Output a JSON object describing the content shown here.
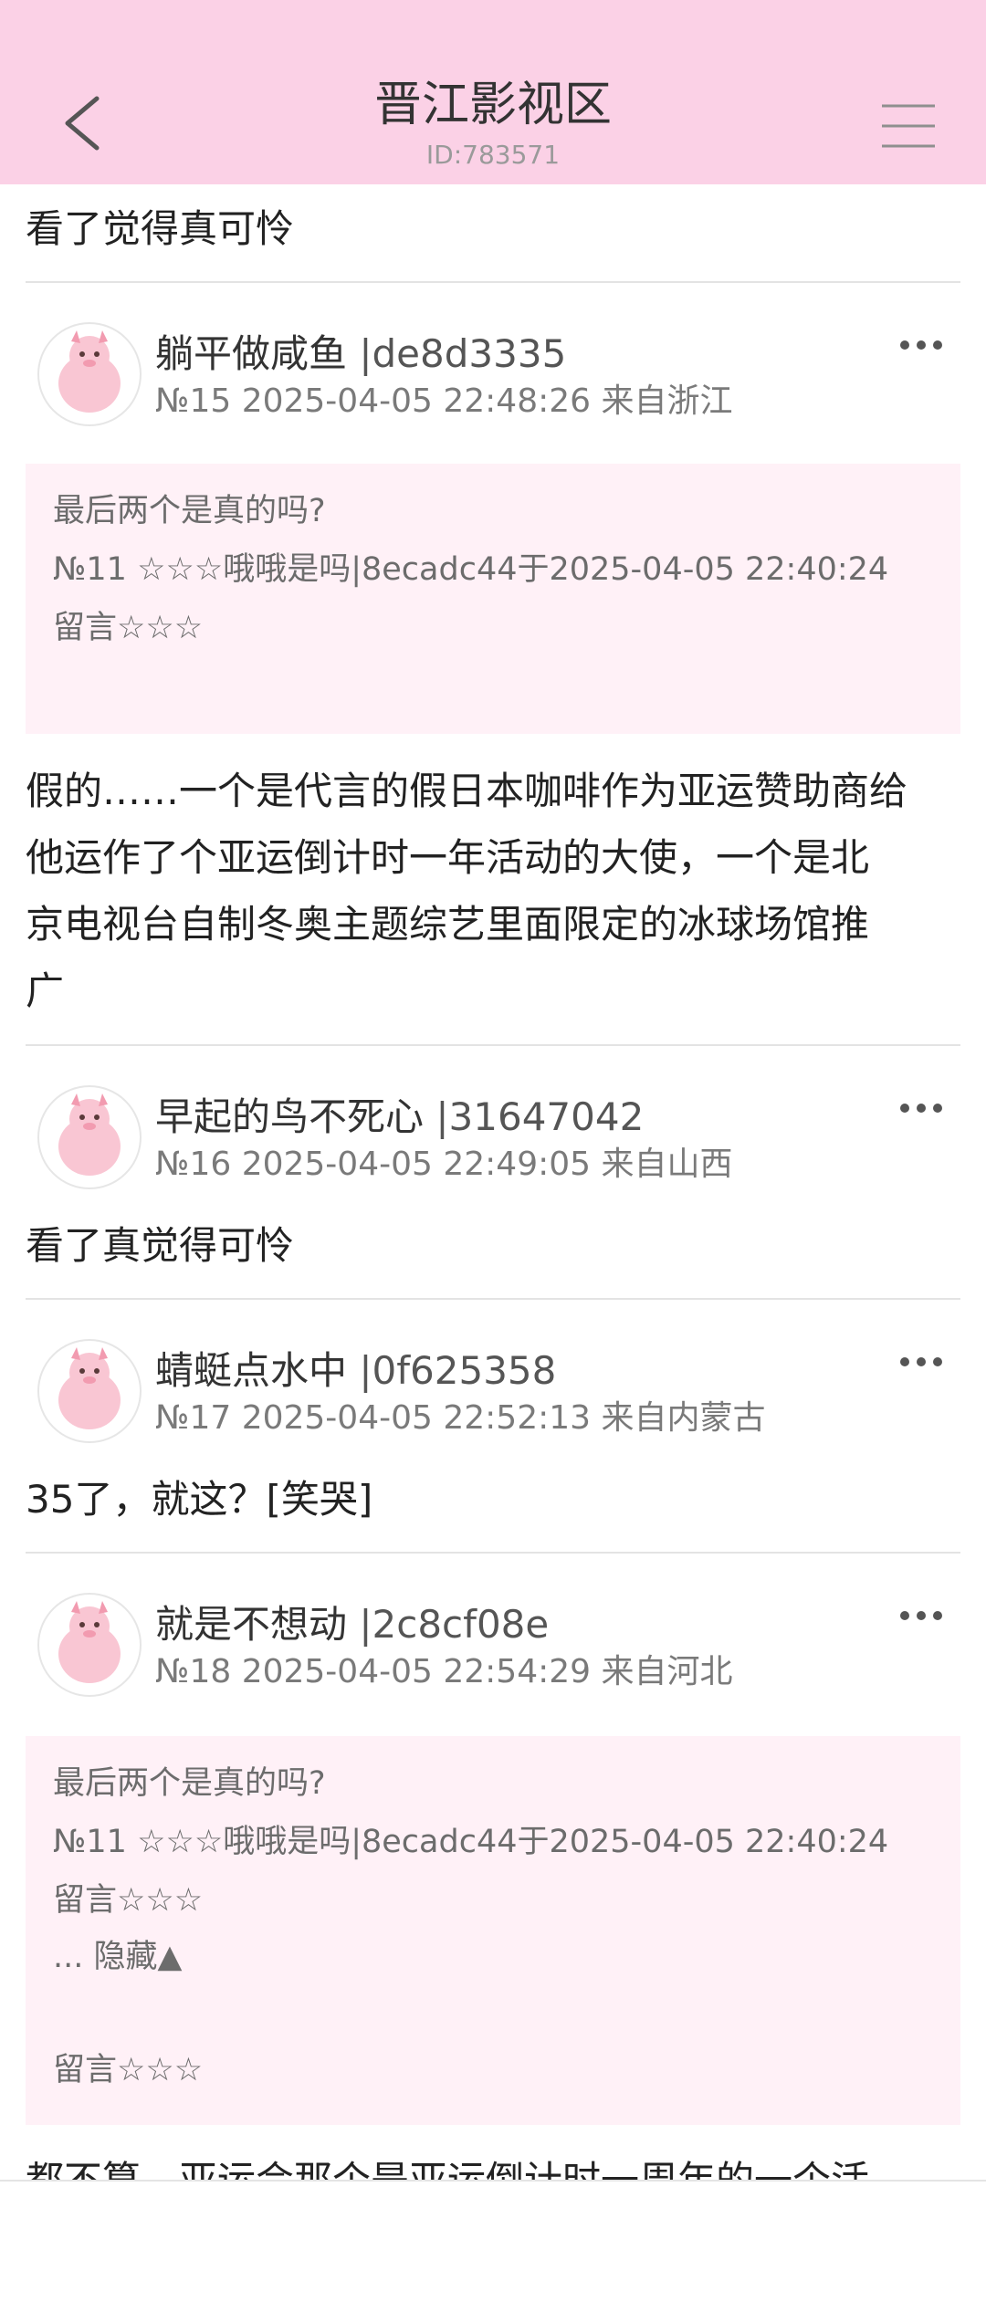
{
  "header": {
    "title": "晋江影视区",
    "subtitle": "ID:783571"
  },
  "top_fragment": "看了觉得真可怜",
  "posts": [
    {
      "username": "躺平做咸鱼",
      "uid": "|de8d3335",
      "meta": "№15 2025-04-05 22:48:26 来自浙江",
      "quote": {
        "line1": "最后两个是真的吗?",
        "line2": "№11 ☆☆☆哦哦是吗|8ecadc44于2025-04-05 22:40:24",
        "line3": "留言☆☆☆"
      },
      "body": [
        "假的……一个是代言的假日本咖啡作为亚运赞助商给",
        "他运作了个亚运倒计时一年活动的大使，一个是北",
        "京电视台自制冬奥主题综艺里面限定的冰球场馆推",
        "广"
      ]
    },
    {
      "username": "早起的鸟不死心",
      "uid": "|31647042",
      "meta": "№16 2025-04-05 22:49:05 来自山西",
      "body": "看了真觉得可怜"
    },
    {
      "username": "蜻蜓点水中",
      "uid": "|0f625358",
      "meta": "№17 2025-04-05 22:52:13 来自内蒙古",
      "body": "35了，就这？[笑哭]"
    },
    {
      "username": "就是不想动",
      "uid": "|2c8cf08e",
      "meta": "№18 2025-04-05 22:54:29 来自河北",
      "quote": {
        "line1": "最后两个是真的吗?",
        "line2": "№11 ☆☆☆哦哦是吗|8ecadc44于2025-04-05 22:40:24",
        "line3": "留言☆☆☆",
        "line4": "... 隐藏▲",
        "line5": "留言☆☆☆"
      },
      "body": "都不算，亚运会那个是亚运倒计时一周年的一个活"
    }
  ],
  "icons": {
    "back": "chevron-left-icon",
    "menu": "hamburger-menu-icon",
    "more": "more-dots-icon",
    "avatar": "pink-pig-avatar"
  },
  "colors": {
    "header_bg": "#fbd1e6",
    "quote_bg": "#fff1f7"
  }
}
